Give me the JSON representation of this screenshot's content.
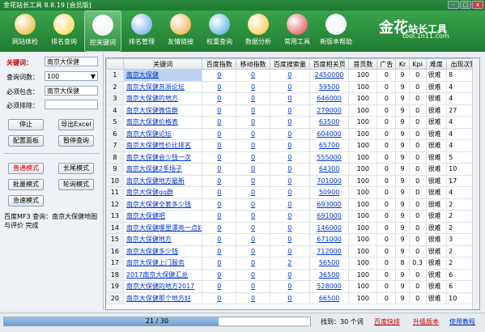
{
  "title": "金花站长工具 8.8.19 [会员版]",
  "window": {
    "min": "-",
    "max": "□",
    "close": "x"
  },
  "toolbar": [
    {
      "label": "网站体检",
      "icon": "stethoscope-icon",
      "color": "#e0b020"
    },
    {
      "label": "排名查询",
      "icon": "bar-chart-icon",
      "color": "#ffd23a"
    },
    {
      "label": "挖关键词",
      "icon": "magnifier-icon",
      "color": "#f0f0f0"
    },
    {
      "label": "排名管理",
      "icon": "grid-icon",
      "color": "#5fa3e8"
    },
    {
      "label": "友情链接",
      "icon": "chain-icon",
      "color": "#e9a020"
    },
    {
      "label": "权重查询",
      "icon": "globe-icon",
      "color": "#3fa6e0"
    },
    {
      "label": "数据分析",
      "icon": "analysis-icon",
      "color": "#f2c230"
    },
    {
      "label": "常用工具",
      "icon": "umbrella-icon",
      "color": "#e23b3b"
    },
    {
      "label": "新版本帮助",
      "icon": "phone-icon",
      "color": "#f0f0f0"
    }
  ],
  "logo": {
    "main": "金花",
    "sub": "站长工具",
    "url": "tool.1n11.com"
  },
  "left": {
    "keyword_label": "关键词：",
    "keyword_value": "南京大保健",
    "count_label": "查询词数：",
    "count_value": "100",
    "include_label": "必须包含：",
    "include_value": "南京大保健",
    "exclude_label": "必须排除：",
    "exclude_value": "",
    "stop": "停止",
    "export": "导出Excel",
    "config": "配置面板",
    "pause": "暂停查询",
    "normal": "普通模式",
    "longtail": "长尾模式",
    "batch": "批量模式",
    "rotate": "轮询模式",
    "fast": "急速模式",
    "status": "百度MF3 查询：南京大保健地图与评价 完成"
  },
  "table": {
    "headers": [
      "",
      "关键词",
      "百度指数",
      "移动指数",
      "百度搜索量",
      "百度相关页",
      "首页数",
      "广告",
      "Kr",
      "Kpi",
      "难度",
      "出现次数"
    ],
    "rows": [
      [
        "1",
        "南京大保健",
        "0",
        "0",
        "0",
        "2450000",
        "100",
        "0",
        "9",
        "0",
        "很难",
        "8"
      ],
      [
        "2",
        "南京大保健苏浙论坛",
        "0",
        "0",
        "0",
        "59500",
        "100",
        "0",
        "9",
        "0",
        "很难",
        "4"
      ],
      [
        "3",
        "南京大保健的地方",
        "0",
        "0",
        "0",
        "646000",
        "100",
        "0",
        "9",
        "0",
        "很难",
        "4"
      ],
      [
        "4",
        "南京大保健微信群",
        "0",
        "0",
        "0",
        "279000",
        "100",
        "0",
        "9",
        "0",
        "很难",
        "27"
      ],
      [
        "5",
        "南京大保健价格表",
        "0",
        "0",
        "0",
        "63500",
        "100",
        "0",
        "9",
        "0",
        "很难",
        "4"
      ],
      [
        "6",
        "南京大保健论坛",
        "0",
        "0",
        "0",
        "604000",
        "100",
        "0",
        "9",
        "0",
        "很难",
        "4"
      ],
      [
        "7",
        "南京大保健性价比排名",
        "0",
        "0",
        "0",
        "65700",
        "100",
        "0",
        "9",
        "0",
        "很难",
        "4"
      ],
      [
        "8",
        "南京大保健会少钱一次",
        "0",
        "0",
        "0",
        "555000",
        "100",
        "0",
        "9",
        "0",
        "很难",
        "5"
      ],
      [
        "9",
        "南京大保健2手场子",
        "0",
        "0",
        "0",
        "64300",
        "100",
        "0",
        "9",
        "0",
        "很难",
        "10"
      ],
      [
        "10",
        "南京大保健地方最新",
        "0",
        "0",
        "0",
        "701000",
        "100",
        "0",
        "9",
        "0",
        "很难",
        "17"
      ],
      [
        "11",
        "南京大保健qq群",
        "0",
        "0",
        "0",
        "50900",
        "100",
        "0",
        "9",
        "0",
        "很难",
        "4"
      ],
      [
        "12",
        "南京大保健全套多少钱",
        "0",
        "0",
        "0",
        "693000",
        "100",
        "0",
        "9",
        "0",
        "很难",
        "2"
      ],
      [
        "13",
        "南京大保健吧",
        "0",
        "0",
        "0",
        "691000",
        "100",
        "0",
        "9",
        "0",
        "很难",
        "2"
      ],
      [
        "14",
        "南京大保健哪里漂亮一点好",
        "0",
        "0",
        "0",
        "146000",
        "100",
        "0",
        "9",
        "0",
        "很难",
        "2"
      ],
      [
        "15",
        "南京大保健地方",
        "0",
        "0",
        "0",
        "671000",
        "100",
        "0",
        "9",
        "0",
        "很难",
        "3"
      ],
      [
        "16",
        "南京大保健多少钱",
        "0",
        "0",
        "0",
        "712000",
        "100",
        "0",
        "9",
        "0",
        "很难",
        "2"
      ],
      [
        "17",
        "南京大保健上门服务",
        "0",
        "0",
        "2",
        "56500",
        "100",
        "0",
        "8",
        "0.3",
        "很难",
        "2"
      ],
      [
        "18",
        "2017南京大保健汇总",
        "0",
        "0",
        "0",
        "36500",
        "100",
        "0",
        "9",
        "0",
        "很难",
        "6"
      ],
      [
        "19",
        "南京大保健的地方2017",
        "0",
        "0",
        "0",
        "528000",
        "100",
        "0",
        "9",
        "0",
        "很难",
        "6"
      ],
      [
        "20",
        "南京大保健那个地方好",
        "0",
        "0",
        "0",
        "66500",
        "100",
        "0",
        "9",
        "0",
        "很难",
        "10"
      ]
    ]
  },
  "status": {
    "progress": "21 / 30",
    "progress_fraction": 0.7,
    "found": "找到：30 个词",
    "link1": "百度快排",
    "link2": "升级版本",
    "link3": "使用教程"
  }
}
